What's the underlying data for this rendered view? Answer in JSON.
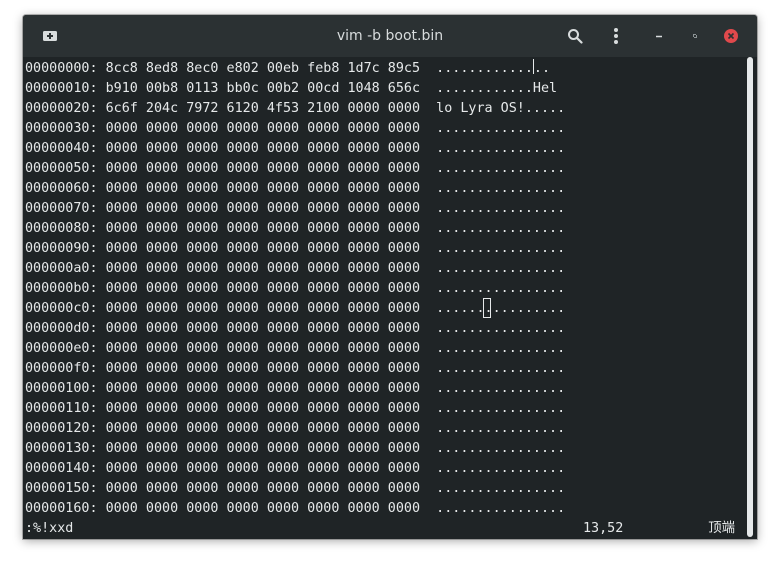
{
  "window": {
    "title": "vim -b boot.bin",
    "icons": {
      "newtab": "new-tab-icon",
      "search": "search-icon",
      "menu": "kebab-menu-icon",
      "minimize": "minimize-icon",
      "maximize": "maximize-icon",
      "close": "close-icon"
    }
  },
  "terminal": {
    "lines": [
      "00000000: 8cc8 8ed8 8ec0 e802 00eb feb8 1d7c 89c5  ............",
      "00000010: b910 00b8 0113 bb0c 00b2 00cd 1048 656c  ............Hel",
      "00000020: 6c6f 204c 7972 6120 4f53 2100 0000 0000  lo Lyra OS!.....",
      "00000030: 0000 0000 0000 0000 0000 0000 0000 0000  ................",
      "00000040: 0000 0000 0000 0000 0000 0000 0000 0000  ................",
      "00000050: 0000 0000 0000 0000 0000 0000 0000 0000  ................",
      "00000060: 0000 0000 0000 0000 0000 0000 0000 0000  ................",
      "00000070: 0000 0000 0000 0000 0000 0000 0000 0000  ................",
      "00000080: 0000 0000 0000 0000 0000 0000 0000 0000  ................",
      "00000090: 0000 0000 0000 0000 0000 0000 0000 0000  ................",
      "000000a0: 0000 0000 0000 0000 0000 0000 0000 0000  ................",
      "000000b0: 0000 0000 0000 0000 0000 0000 0000 0000  ................",
      "000000c0: 0000 0000 0000 0000 0000 0000 0000 0000  ................",
      "000000d0: 0000 0000 0000 0000 0000 0000 0000 0000  ................",
      "000000e0: 0000 0000 0000 0000 0000 0000 0000 0000  ................",
      "000000f0: 0000 0000 0000 0000 0000 0000 0000 0000  ................",
      "00000100: 0000 0000 0000 0000 0000 0000 0000 0000  ................",
      "00000110: 0000 0000 0000 0000 0000 0000 0000 0000  ................",
      "00000120: 0000 0000 0000 0000 0000 0000 0000 0000  ................",
      "00000130: 0000 0000 0000 0000 0000 0000 0000 0000  ................",
      "00000140: 0000 0000 0000 0000 0000 0000 0000 0000  ................",
      "00000150: 0000 0000 0000 0000 0000 0000 0000 0000  ................",
      "00000160: 0000 0000 0000 0000 0000 0000 0000 0000  ................"
    ],
    "line0_tail": ".."
  },
  "statusline": {
    "command": ":%!xxd",
    "position": "13,52",
    "location": "顶端"
  },
  "colors": {
    "background": "#1f2426",
    "titlebar": "#2b3133",
    "text": "#e6e9ea",
    "close_button": "#e0494c"
  }
}
